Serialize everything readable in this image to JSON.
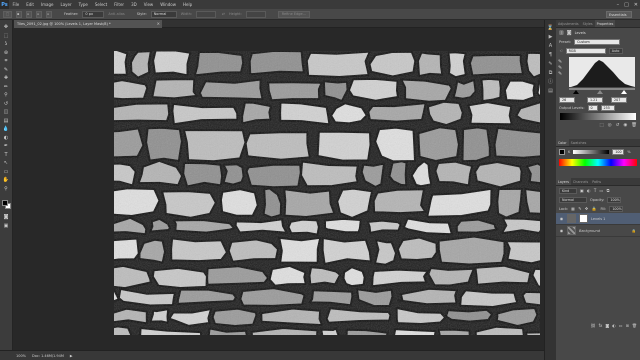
{
  "app": {
    "logo": "Ps"
  },
  "menu": [
    "File",
    "Edit",
    "Image",
    "Layer",
    "Type",
    "Select",
    "Filter",
    "3D",
    "View",
    "Window",
    "Help"
  ],
  "window_controls": [
    "–",
    "□",
    "✕"
  ],
  "options": {
    "feather_label": "Feather:",
    "feather_value": "0 px",
    "antialias_label": "Anti-alias",
    "style_label": "Style:",
    "style_value": "Normal",
    "width_label": "Width:",
    "height_label": "Height:",
    "refine_label": "Refine Edge...",
    "workspace": "Essentials"
  },
  "tools": [
    "move-tool",
    "marquee-tool",
    "lasso-tool",
    "quick-select-tool",
    "crop-tool",
    "eyedropper-tool",
    "healing-tool",
    "brush-tool",
    "clone-stamp-tool",
    "history-brush-tool",
    "eraser-tool",
    "gradient-tool",
    "blur-tool",
    "dodge-tool",
    "pen-tool",
    "type-tool",
    "path-select-tool",
    "shape-tool",
    "hand-tool",
    "zoom-tool"
  ],
  "tool_glyphs": [
    "✥",
    "⬚",
    "ʖ",
    "⊛",
    "⌗",
    "✎",
    "✚",
    "✏",
    "⚲",
    "↺",
    "◫",
    "▤",
    "💧",
    "◐",
    "✒",
    "T",
    "↖",
    "▭",
    "✋",
    "⚲"
  ],
  "document": {
    "tab_title": "Tiles_2091_02.jpg @ 100% (Levels 1, Layer Mask/8) *",
    "close": "×"
  },
  "status": {
    "zoom": "100%",
    "doc_info": "Doc: 1.46M/1.94M",
    "arrow": "▶"
  },
  "panels": {
    "adjust_tabs": [
      "Adjustments",
      "Styles",
      "Properties"
    ],
    "levels_title": "Levels",
    "preset_label": "Preset:",
    "preset_value": "Custom",
    "channel_value": "RGB",
    "auto_label": "Auto",
    "input_values": [
      "26",
      "1.21",
      "207"
    ],
    "output_label": "Output Levels:",
    "output_values": [
      "0",
      "255"
    ],
    "color_tabs": [
      "Color",
      "Swatches"
    ],
    "color_k_label": "K",
    "color_k_value": "100",
    "color_pct": "%",
    "layers_tabs": [
      "Layers",
      "Channels",
      "Paths"
    ],
    "kind_label": "Kind",
    "blend_mode": "Normal",
    "opacity_label": "Opacity:",
    "opacity_value": "100%",
    "lock_label": "Lock:",
    "fill_label": "Fill:",
    "fill_value": "100%",
    "layers": [
      {
        "name": "Levels 1",
        "selected": true
      },
      {
        "name": "Background",
        "selected": false
      }
    ],
    "footer_icons": [
      "link-icon",
      "fx-icon",
      "mask-icon",
      "adjust-icon",
      "folder-icon",
      "new-layer-icon",
      "trash-icon"
    ],
    "footer_glyphs": [
      "⛓",
      "fx",
      "◙",
      "◐",
      "▭",
      "⊞",
      "🗑"
    ]
  },
  "icon_strip": [
    "history-icon",
    "actions-icon",
    "char-icon",
    "para-icon",
    "brush-icon",
    "clone-icon",
    "info-icon",
    "nav-icon"
  ],
  "icon_strip_glyphs": [
    "⌛",
    "▶",
    "A",
    "¶",
    "✎",
    "⧉",
    "ⓘ",
    "▤"
  ],
  "colors": {
    "accent": "#51a8ff",
    "selection": "#505e74",
    "panel": "#484848",
    "chrome": "#3a3a3a"
  }
}
